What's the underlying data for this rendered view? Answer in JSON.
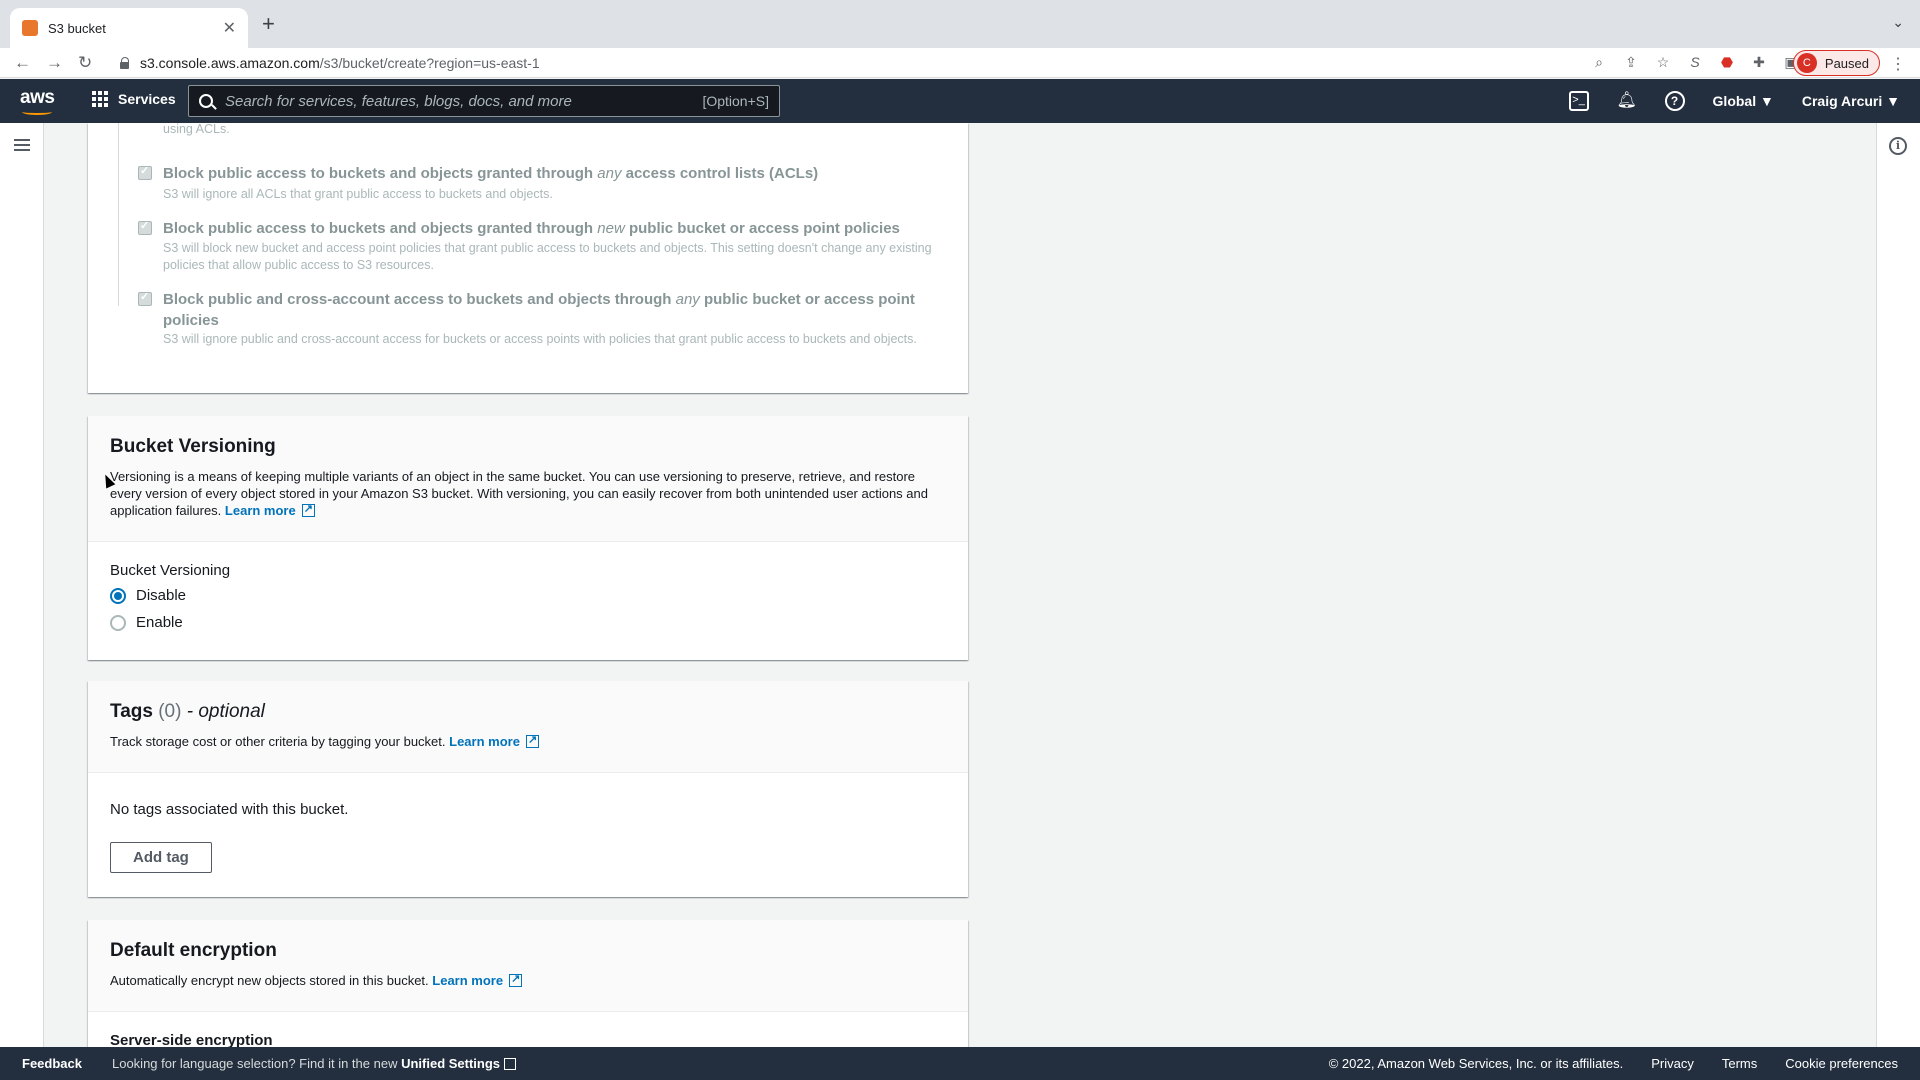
{
  "browser": {
    "tab_title": "S3 bucket",
    "url_host": "s3.console.aws.amazon.com",
    "url_path": "/s3/bucket/create?region=us-east-1",
    "profile_initial": "C",
    "profile_status": "Paused"
  },
  "aws_nav": {
    "logo": "aws",
    "services": "Services",
    "search_placeholder": "Search for services, features, blogs, docs, and more",
    "search_shortcut": "[Option+S]",
    "region": "Global ▼",
    "user": "Craig Arcuri ▼"
  },
  "block_public_access": {
    "cut_text": "using ACLs.",
    "items": [
      {
        "title_before": "Block public access to buckets and objects granted through ",
        "title_em": "any",
        "title_after": " access control lists (ACLs)",
        "desc": "S3 will ignore all ACLs that grant public access to buckets and objects."
      },
      {
        "title_before": "Block public access to buckets and objects granted through ",
        "title_em": "new",
        "title_after": " public bucket or access point policies",
        "desc": "S3 will block new bucket and access point policies that grant public access to buckets and objects. This setting doesn't change any existing policies that allow public access to S3 resources."
      },
      {
        "title_before": "Block public and cross-account access to buckets and objects through ",
        "title_em": "any",
        "title_after": " public bucket or access point policies",
        "desc": "S3 will ignore public and cross-account access for buckets or access points with policies that grant public access to buckets and objects."
      }
    ]
  },
  "versioning": {
    "title": "Bucket Versioning",
    "description": "Versioning is a means of keeping multiple variants of an object in the same bucket. You can use versioning to preserve, retrieve, and restore every version of every object stored in your Amazon S3 bucket. With versioning, you can easily recover from both unintended user actions and application failures.",
    "learn_more": "Learn more",
    "field_label": "Bucket Versioning",
    "options": [
      "Disable",
      "Enable"
    ],
    "selected": "Disable"
  },
  "tags": {
    "title": "Tags",
    "count": "(0)",
    "optional": "- optional",
    "description": "Track storage cost or other criteria by tagging your bucket.",
    "learn_more": "Learn more",
    "empty_text": "No tags associated with this bucket.",
    "add_button": "Add tag"
  },
  "encryption": {
    "title": "Default encryption",
    "description": "Automatically encrypt new objects stored in this bucket.",
    "learn_more": "Learn more",
    "sub_label": "Server-side encryption"
  },
  "footer": {
    "feedback": "Feedback",
    "lang_prefix": "Looking for language selection? Find it in the new",
    "unified_settings": "Unified Settings",
    "copyright": "© 2022, Amazon Web Services, Inc. or its affiliates.",
    "privacy": "Privacy",
    "terms": "Terms",
    "cookie": "Cookie preferences"
  },
  "colors": {
    "aws_nav_bg": "#232f3e",
    "link": "#0073bb",
    "accent": "#ff9900"
  }
}
